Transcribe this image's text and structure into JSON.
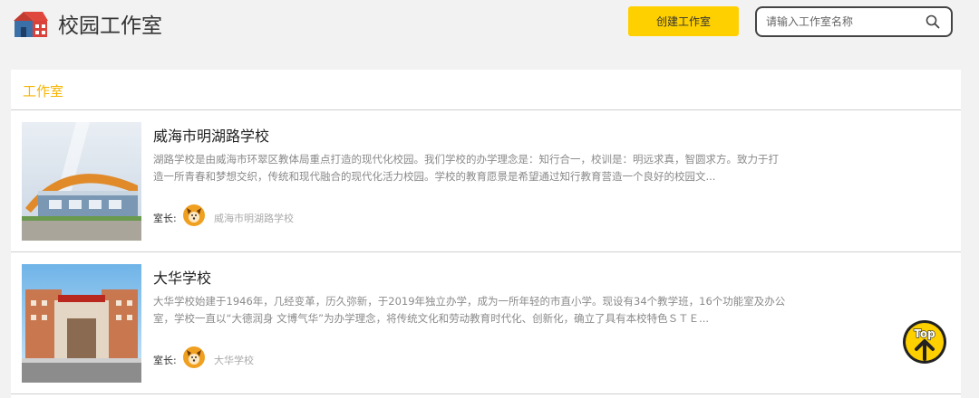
{
  "header": {
    "app_title": "校园工作室",
    "create_label": "创建工作室",
    "search": {
      "placeholder": "请输入工作室名称",
      "value": ""
    }
  },
  "section": {
    "title": "工作室"
  },
  "studios": [
    {
      "name": "威海市明湖路学校",
      "description": "湖路学校是由威海市环翠区教体局重点打造的现代化校园。我们学校的办学理念是：知行合一，校训是：明远求真，智圆求方。致力于打造一所青春和梦想交织，传统和现代融合的现代化活力校园。学校的教育愿景是希望通过知行教育营造一个良好的校园文...",
      "owner_label": "室长:",
      "owner_name": "威海市明湖路学校"
    },
    {
      "name": "大华学校",
      "description": "大华学校始建于1946年，几经变革，历久弥新，于2019年独立办学，成为一所年轻的市直小学。现设有34个教学班，16个功能室及办公室，学校一直以“大德润身 文博气华”为办学理念，将传统文化和劳动教育时代化、创新化，确立了具有本校特色ＳＴＥ...",
      "owner_label": "室长:",
      "owner_name": "大华学校"
    }
  ],
  "colors": {
    "accent": "#ffd000",
    "section_title": "#f5b400",
    "background": "#f2f2f2"
  },
  "icons": {
    "logo": "school-house-icon",
    "search": "search-icon",
    "avatar": "fox-avatar-icon",
    "top": "back-to-top-icon"
  },
  "top_button": {
    "label": "Top"
  }
}
